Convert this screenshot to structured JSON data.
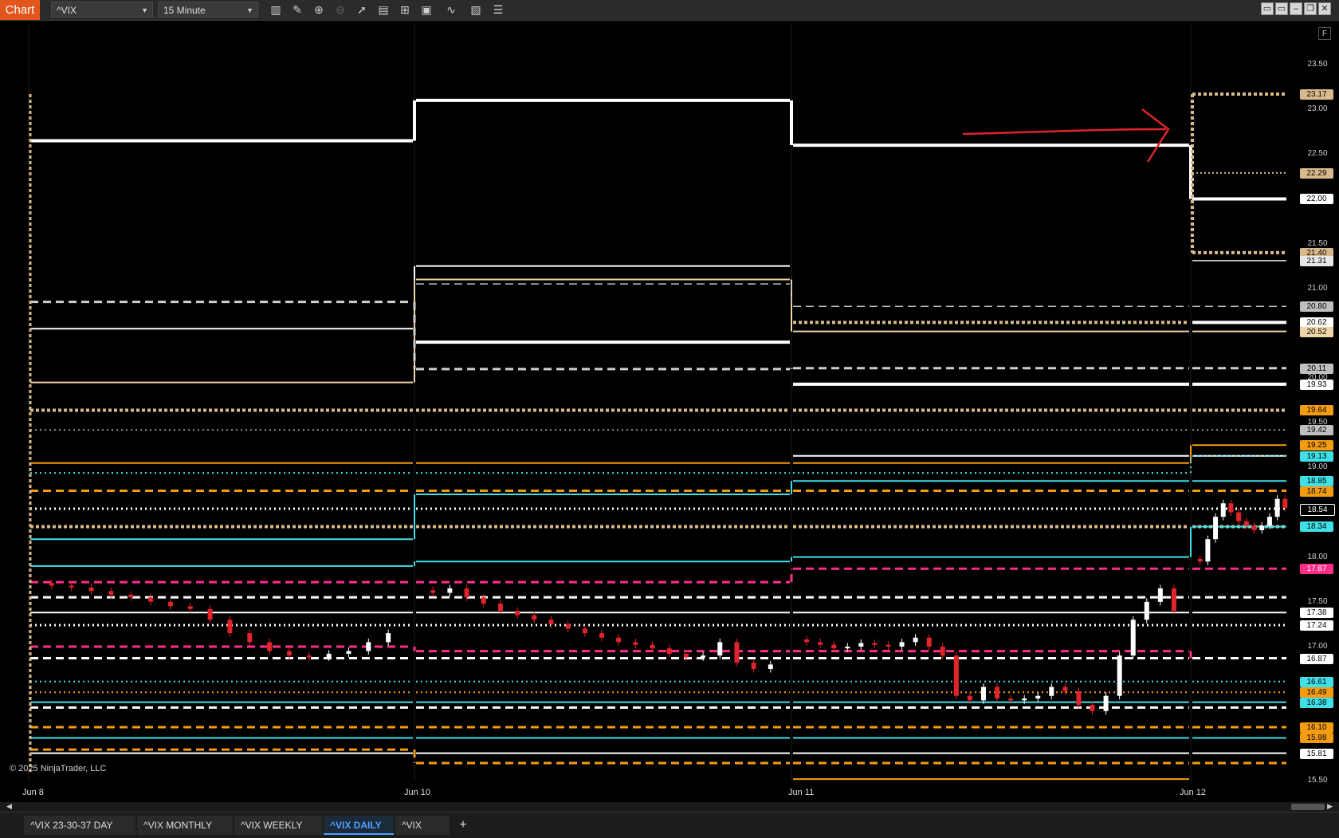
{
  "toolbar": {
    "chart_tab": "Chart",
    "instrument": "^VIX",
    "interval": "15 Minute",
    "icons": [
      "bar-style-icon",
      "draw-icon",
      "zoom-in-icon",
      "zoom-out-icon",
      "pointer-icon",
      "data-box-icon",
      "template-icon",
      "properties-icon",
      "indicators-icon",
      "strategy-icon",
      "list-icon"
    ]
  },
  "plot": {
    "copyright": "© 2025 NinjaTrader, LLC",
    "f_button": "F",
    "annotation": "red-arrow-right"
  },
  "axis": {
    "ticks": [
      "23.50",
      "23.00",
      "22.50",
      "22.00",
      "21.50",
      "21.00",
      "20.50",
      "20.00",
      "19.50",
      "19.00",
      "18.50",
      "18.00",
      "17.50",
      "17.00",
      "16.50",
      "16.00",
      "15.50"
    ],
    "tick_values": [
      23.5,
      23.0,
      22.5,
      22.0,
      21.5,
      21.0,
      20.5,
      20.0,
      19.5,
      19.0,
      18.5,
      18.0,
      17.5,
      17.0,
      16.5,
      16.0,
      15.5
    ]
  },
  "price_tags": [
    {
      "text": "23.17",
      "value": 23.17,
      "bg": "#d8b98c",
      "fg": "#000"
    },
    {
      "text": "22.29",
      "value": 22.29,
      "bg": "#d8b98c",
      "fg": "#000"
    },
    {
      "text": "22.00",
      "value": 22.0,
      "bg": "#ffffff",
      "fg": "#000"
    },
    {
      "text": "21.40",
      "value": 21.4,
      "bg": "#d8b98c",
      "fg": "#000"
    },
    {
      "text": "21.31",
      "value": 21.31,
      "bg": "#e8e8e8",
      "fg": "#000"
    },
    {
      "text": "20.80",
      "value": 20.8,
      "bg": "#bfbfbf",
      "fg": "#000"
    },
    {
      "text": "20.62",
      "value": 20.62,
      "bg": "#ffffff",
      "fg": "#000"
    },
    {
      "text": "20.52",
      "value": 20.52,
      "bg": "#f0d5a8",
      "fg": "#000"
    },
    {
      "text": "20.11",
      "value": 20.11,
      "bg": "#bfbfbf",
      "fg": "#000"
    },
    {
      "text": "19.93",
      "value": 19.93,
      "bg": "#ffffff",
      "fg": "#000"
    },
    {
      "text": "19.64",
      "value": 19.64,
      "bg": "#f39c12",
      "fg": "#000"
    },
    {
      "text": "19.42",
      "value": 19.42,
      "bg": "#bfbfbf",
      "fg": "#000"
    },
    {
      "text": "19.25",
      "value": 19.25,
      "bg": "#f39c12",
      "fg": "#000"
    },
    {
      "text": "19.13",
      "value": 19.13,
      "bg": "#3fe0e8",
      "fg": "#000"
    },
    {
      "text": "18.85",
      "value": 18.85,
      "bg": "#3fe0e8",
      "fg": "#000"
    },
    {
      "text": "18.74",
      "value": 18.74,
      "bg": "#f39c12",
      "fg": "#000"
    },
    {
      "text": "18.54",
      "value": 18.54,
      "bg": "#000000",
      "fg": "#ffffff"
    },
    {
      "text": "18.34",
      "value": 18.34,
      "bg": "#3fe0e8",
      "fg": "#000"
    },
    {
      "text": "17.87",
      "value": 17.87,
      "bg": "#ff2d8a",
      "fg": "#fff"
    },
    {
      "text": "17.38",
      "value": 17.38,
      "bg": "#ffffff",
      "fg": "#000"
    },
    {
      "text": "17.24",
      "value": 17.24,
      "bg": "#ffffff",
      "fg": "#000"
    },
    {
      "text": "16.87",
      "value": 16.87,
      "bg": "#ffffff",
      "fg": "#000"
    },
    {
      "text": "16.61",
      "value": 16.61,
      "bg": "#3fe0e8",
      "fg": "#000"
    },
    {
      "text": "16.49",
      "value": 16.49,
      "bg": "#f39c12",
      "fg": "#000"
    },
    {
      "text": "16.38",
      "value": 16.38,
      "bg": "#3fe0e8",
      "fg": "#000"
    },
    {
      "text": "16.10",
      "value": 16.1,
      "bg": "#f39c12",
      "fg": "#000"
    },
    {
      "text": "15.98",
      "value": 15.98,
      "bg": "#f39c12",
      "fg": "#000"
    },
    {
      "text": "15.81",
      "value": 15.81,
      "bg": "#ffffff",
      "fg": "#000"
    }
  ],
  "dates": [
    "Jun 8",
    "Jun 10",
    "Jun 11",
    "Jun 12"
  ],
  "tabs": [
    "^VIX 23-30-37 DAY",
    "^VIX MONTHLY",
    "^VIX WEEKLY",
    "^VIX DAILY",
    "^VIX"
  ],
  "active_tab": 3,
  "tab_add": "+",
  "colors": {
    "background": "#000000",
    "white": "#ffffff",
    "tan": "#d8b98c",
    "orange": "#f39c12",
    "cyan": "#3fe0e8",
    "magenta": "#ff2d8a",
    "candle_up": "#ffffff",
    "candle_down": "#e0242c"
  },
  "chart_data": {
    "type": "candlestick",
    "instrument": "^VIX",
    "interval": "15 Minute",
    "ylim": [
      15.5,
      23.6
    ],
    "x": [
      "Jun 8",
      "Jun 10",
      "Jun 11",
      "Jun 12"
    ],
    "sessions": [
      {
        "label": "Jun 8",
        "close_path": [
          17.68,
          17.66,
          17.62,
          17.58,
          17.55,
          17.5,
          17.45,
          17.42,
          17.3,
          17.15,
          17.05,
          16.95,
          16.9,
          16.88,
          16.92,
          16.95,
          17.05,
          17.15
        ]
      },
      {
        "label": "Jun 10",
        "close_path": [
          17.6,
          17.65,
          17.55,
          17.48,
          17.4,
          17.35,
          17.3,
          17.25,
          17.2,
          17.15,
          17.1,
          17.05,
          17.02,
          16.98,
          16.92,
          16.88,
          16.9,
          17.05,
          16.82,
          16.75,
          16.8
        ]
      },
      {
        "label": "Jun 11",
        "close_path": [
          17.05,
          17.02,
          16.98,
          17.0,
          17.04,
          17.02,
          17.0,
          17.05,
          17.1,
          17.0,
          16.9,
          16.45,
          16.4,
          16.55,
          16.42,
          16.4,
          16.42,
          16.45,
          16.55,
          16.5,
          16.35,
          16.28,
          16.45,
          16.9,
          17.3,
          17.5,
          17.65,
          17.4
        ]
      },
      {
        "label": "Jun 12",
        "close_path": [
          17.95,
          18.2,
          18.45,
          18.6,
          18.5,
          18.4,
          18.35,
          18.3,
          18.35,
          18.45,
          18.65,
          18.55
        ]
      }
    ]
  }
}
